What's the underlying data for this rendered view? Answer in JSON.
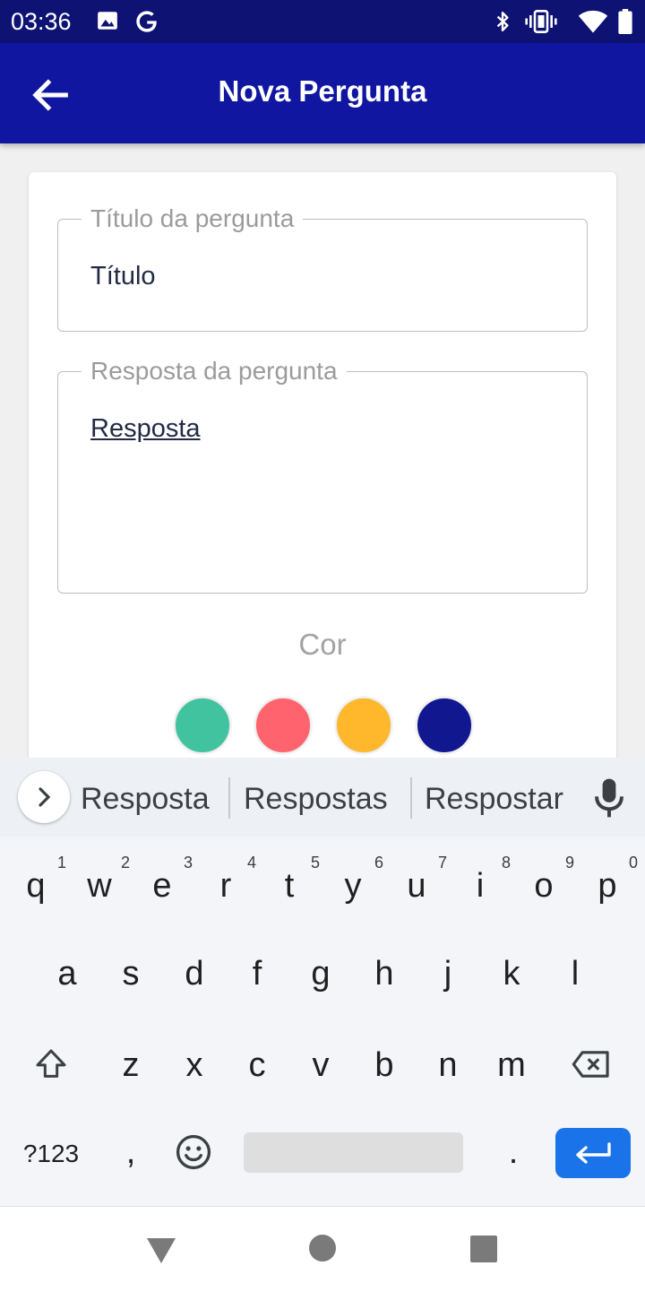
{
  "status_bar": {
    "time": "03:36",
    "icons": [
      "image-icon",
      "google-icon",
      "bluetooth-icon",
      "vibrate-icon",
      "wifi-icon",
      "battery-icon"
    ]
  },
  "app_bar": {
    "title": "Nova Pergunta",
    "back_icon": "arrow-back-icon"
  },
  "form": {
    "title_field": {
      "label": "Título da pergunta",
      "value": "Título"
    },
    "answer_field": {
      "label": "Resposta da pergunta",
      "value": "Resposta"
    },
    "color_label": "Cor",
    "colors": [
      "#41c3a0",
      "#ff646e",
      "#ffb82c",
      "#11178f"
    ]
  },
  "keyboard": {
    "suggestions": [
      "Resposta",
      "Respostas",
      "Respostar"
    ],
    "row1": [
      "q",
      "w",
      "e",
      "r",
      "t",
      "y",
      "u",
      "i",
      "o",
      "p"
    ],
    "row1_hints": [
      "1",
      "2",
      "3",
      "4",
      "5",
      "6",
      "7",
      "8",
      "9",
      "0"
    ],
    "row2": [
      "a",
      "s",
      "d",
      "f",
      "g",
      "h",
      "j",
      "k",
      "l"
    ],
    "row3": [
      "z",
      "x",
      "c",
      "v",
      "b",
      "n",
      "m"
    ],
    "symbols_label": "?123",
    "comma": ",",
    "period": ".",
    "accent": "#1a73e8"
  },
  "nav_bar": {
    "icons": [
      "back-triangle-icon",
      "home-circle-icon",
      "recents-square-icon"
    ]
  }
}
